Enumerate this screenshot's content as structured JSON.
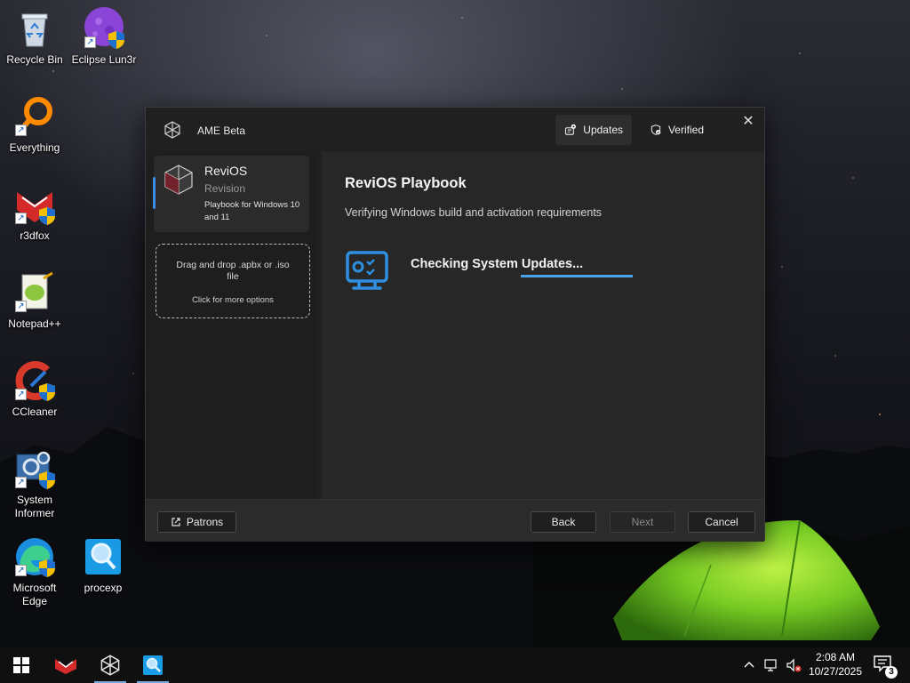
{
  "desktop": {
    "icons": [
      {
        "label": "Recycle Bin",
        "icon": "recycle-bin-icon"
      },
      {
        "label": "Eclipse Lun3r",
        "icon": "eclipse-lun3r-icon"
      },
      {
        "label": "Everything",
        "icon": "everything-search-icon"
      },
      {
        "label": "r3dfox",
        "icon": "r3dfox-browser-icon"
      },
      {
        "label": "Notepad++",
        "icon": "notepad-plus-plus-icon"
      },
      {
        "label": "CCleaner",
        "icon": "ccleaner-icon"
      },
      {
        "label": "System Informer",
        "icon": "system-informer-icon"
      },
      {
        "label": "Microsoft Edge",
        "icon": "microsoft-edge-icon"
      },
      {
        "label": "procexp",
        "icon": "process-explorer-icon"
      }
    ]
  },
  "dialog": {
    "app_name": "AME Beta",
    "header_buttons": {
      "updates": "Updates",
      "verified": "Verified"
    },
    "close": "✕",
    "playbook": {
      "name": "ReviOS",
      "revision": "Revision",
      "description": "Playbook for Windows 10 and 11"
    },
    "dropzone": {
      "main": "Drag and drop .apbx or .iso file",
      "sub": "Click for more options"
    },
    "main": {
      "title": "ReviOS Playbook",
      "subtitle": "Verifying Windows build and activation requirements",
      "status": "Checking System Updates...",
      "progress": 1.0
    },
    "footer": {
      "patrons": "Patrons",
      "back": "Back",
      "next": "Next",
      "cancel": "Cancel"
    }
  },
  "taskbar": {
    "apps": [
      "start-icon",
      "r3dfox-browser-icon",
      "ame-wizard-icon",
      "process-explorer-icon"
    ],
    "time": "2:08 AM",
    "date": "10/27/2025",
    "notification_count": "3"
  },
  "colors": {
    "accent": "#4aa3e8",
    "dialog_bg": "#202020",
    "taskbar_bg": "#101010"
  }
}
